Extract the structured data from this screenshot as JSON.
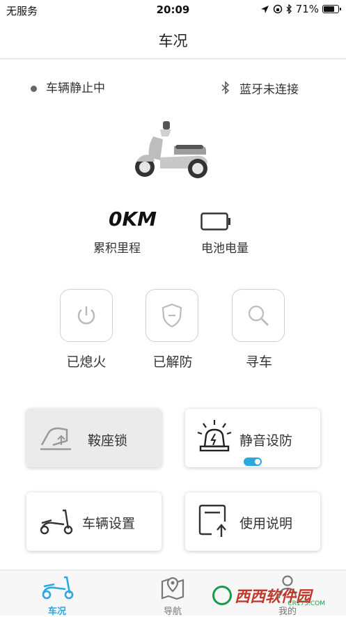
{
  "status_bar": {
    "carrier": "无服务",
    "time": "20:09",
    "battery": "71%"
  },
  "header": {
    "title": "车况"
  },
  "vehicle_status": {
    "state": "车辆静止中",
    "bluetooth": "蓝牙未连接"
  },
  "stats": {
    "mileage_value": "0KM",
    "mileage_label": "累积里程",
    "battery_label": "电池电量"
  },
  "quick_actions": [
    {
      "label": "已熄火",
      "icon": "power-icon"
    },
    {
      "label": "已解防",
      "icon": "shield-icon"
    },
    {
      "label": "寻车",
      "icon": "search-icon"
    }
  ],
  "cards": [
    {
      "label": "鞍座锁",
      "icon": "seat-lock-icon"
    },
    {
      "label": "静音设防",
      "icon": "alarm-icon",
      "toggle_on": true
    },
    {
      "label": "车辆设置",
      "icon": "scooter-icon"
    },
    {
      "label": "使用说明",
      "icon": "manual-icon"
    }
  ],
  "tabs": [
    {
      "label": "车况",
      "icon": "scooter-icon",
      "active": true
    },
    {
      "label": "导航",
      "icon": "map-icon",
      "active": false
    },
    {
      "label": "我的",
      "icon": "user-icon",
      "active": false
    }
  ],
  "watermark": {
    "text": "西西软件园",
    "sub": "CR173.COM"
  },
  "colors": {
    "accent": "#2aa8e0",
    "inactive": "#777777",
    "card_pressed": "#ebebeb"
  }
}
